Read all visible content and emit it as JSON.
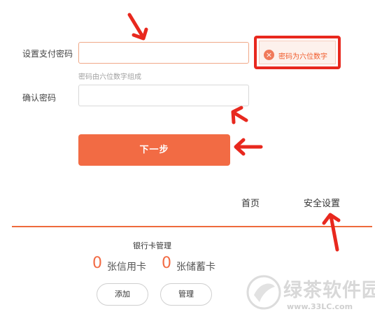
{
  "form": {
    "pay_password_label": "设置支付密码",
    "pay_password_hint": "密码由六位数字组成",
    "confirm_password_label": "确认密码",
    "error_message": "密码为六位数字",
    "error_icon_glyph": "×",
    "next_button_label": "下一步"
  },
  "nav": {
    "home_label": "首页",
    "security_label": "安全设置"
  },
  "bank_card": {
    "title": "银行卡管理",
    "credit_count": "0",
    "credit_label": "张信用卡",
    "debit_count": "0",
    "debit_label": "张储蓄卡",
    "add_label": "添加",
    "manage_label": "管理"
  },
  "watermark": {
    "logo_text": "绿茶软件园",
    "url": "www.33LC.com"
  },
  "colors": {
    "accent": "#f26b44",
    "annotation_red": "#e8281e"
  },
  "annotations": {
    "arrow_icon": "red-arrow-icon"
  }
}
